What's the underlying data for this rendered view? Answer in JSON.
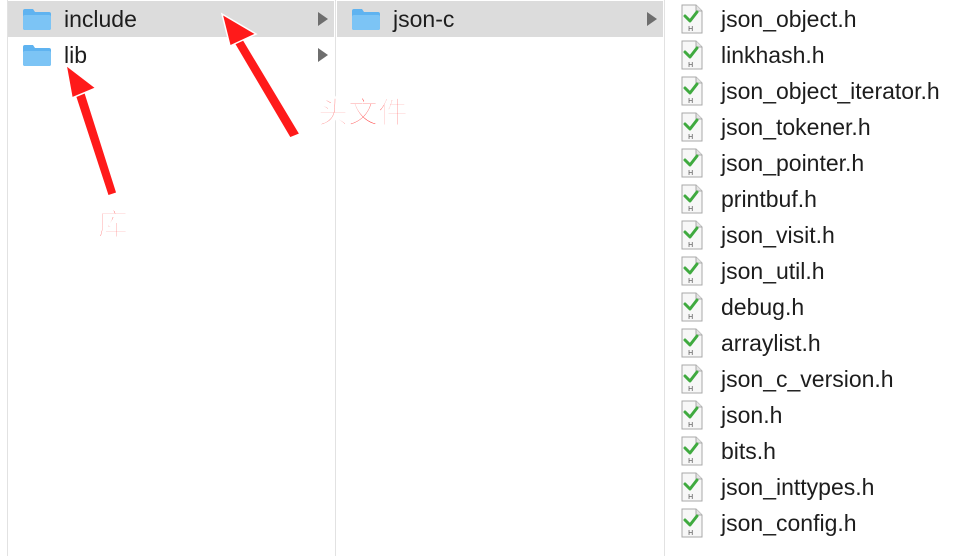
{
  "columns": {
    "col1": {
      "items": [
        {
          "label": "include",
          "selected": true,
          "has_children": true
        },
        {
          "label": "lib",
          "selected": false,
          "has_children": true
        }
      ]
    },
    "col2": {
      "items": [
        {
          "label": "json-c",
          "selected": true,
          "has_children": true
        }
      ]
    },
    "col3": {
      "files": [
        "json_object.h",
        "linkhash.h",
        "json_object_iterator.h",
        "json_tokener.h",
        "json_pointer.h",
        "printbuf.h",
        "json_visit.h",
        "json_util.h",
        "debug.h",
        "arraylist.h",
        "json_c_version.h",
        "json.h",
        "bits.h",
        "json_inttypes.h",
        "json_config.h"
      ]
    }
  },
  "annotations": {
    "header_label": "头文件",
    "lib_label": "库"
  },
  "colors": {
    "folder": "#5fb3f0",
    "selected_row": "#dcdcdc",
    "annotation": "#ff1a1a",
    "chevron": "#6e6e6e"
  },
  "icons": {
    "folder": "folder-icon",
    "header_file": "header-file-icon",
    "disclosure": "chevron-right-icon"
  }
}
